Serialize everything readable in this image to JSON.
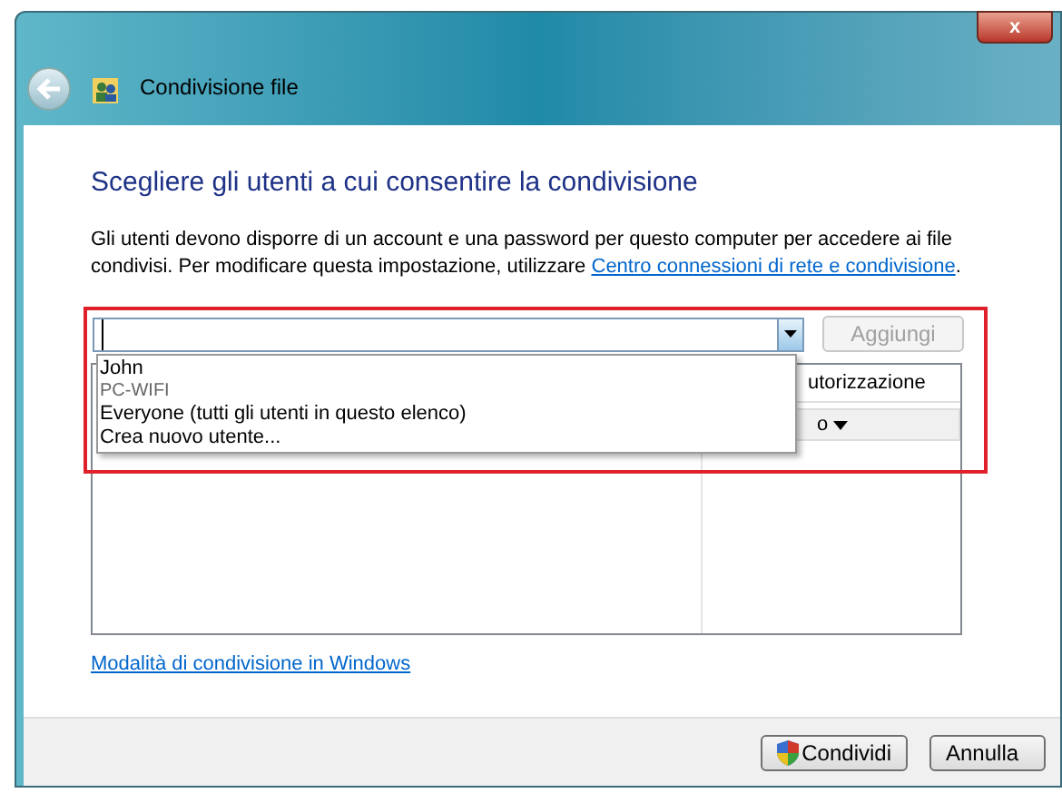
{
  "window": {
    "title": "Condivisione file",
    "close": "x"
  },
  "heading": "Scegliere gli utenti a cui consentire la condivisione",
  "description": "Gli utenti devono disporre di un account e una password per questo computer per accedere ai file condivisi. Per modificare questa impostazione, utilizzare",
  "description_link": "Centro connessioni di rete e condivisione",
  "description_end": ".",
  "user_combo": {
    "add_button": "Aggiungi",
    "add_disabled": true,
    "options": [
      {
        "label": "John",
        "kind": "user"
      },
      {
        "label": "PC-WIFI",
        "kind": "group"
      },
      {
        "label": "Everyone (tutti gli utenti in questo elenco)",
        "kind": "user"
      },
      {
        "label": "Crea nuovo utente...",
        "kind": "user"
      }
    ]
  },
  "table": {
    "columns": [
      "utorizzazione"
    ],
    "rows": [
      {
        "cells": [
          "o"
        ],
        "dropdown": true
      }
    ]
  },
  "help_link": "Modalità di condivisione in Windows",
  "buttons": [
    {
      "label": "Condividi",
      "kind": "shield"
    },
    {
      "label": "Annulla",
      "kind": "plain"
    }
  ]
}
